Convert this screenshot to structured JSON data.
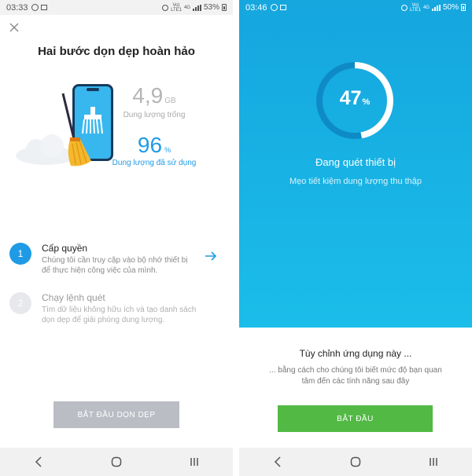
{
  "left": {
    "status": {
      "time": "03:33",
      "net_top": "Vo)",
      "net_bottom": "LTE1",
      "net_gen": "4G",
      "battery": "53%"
    },
    "title": "Hai bước dọn dẹp hoàn hảo",
    "storage": {
      "free_value": "4,9",
      "free_unit": "GB",
      "free_label": "Dung lượng trống",
      "used_value": "96",
      "used_unit": "%",
      "used_label": "Dung lượng đã sử dụng"
    },
    "steps": [
      {
        "number": "1",
        "title": "Cấp quyền",
        "desc_line1": "Chúng tôi cần truy cập vào bộ nhớ thiết bị",
        "desc_line2": "để thực hiện công việc của mình."
      },
      {
        "number": "2",
        "title": "Chạy lệnh quét",
        "desc_line1": "Tìm dữ liệu không hữu ích và tạo danh sách",
        "desc_line2": "dọn dẹp để giải phóng dung lượng."
      }
    ],
    "start_button": "BẮT ĐẦU DỌN DẸP"
  },
  "right": {
    "status": {
      "time": "03:46",
      "net_top": "Vo)",
      "net_bottom": "LTE1",
      "net_gen": "4G",
      "battery": "50%"
    },
    "progress": {
      "value": "47",
      "unit": "%",
      "fraction": 0.47
    },
    "scan_title": "Đang quét thiết bị",
    "scan_subtitle": "Mẹo tiết kiệm dung lượng thu thập",
    "custom_title": "Tùy chỉnh ứng dụng này ...",
    "custom_desc_line1": "... bằng cách cho chúng tôi biết mức độ bạn quan",
    "custom_desc_line2": "tâm đến các tính năng sau đây",
    "start_button": "BẮT ĐẦU"
  },
  "icons": {
    "close": "close-icon",
    "arrow": "arrow-right-icon",
    "nav_back": "back-icon",
    "nav_home": "home-icon",
    "nav_recent": "recent-apps-icon"
  },
  "colors": {
    "accent_blue": "#1f9be6",
    "scan_blue": "#16a7df",
    "start_green": "#52b944",
    "disabled_gray": "#bbbdc4"
  }
}
